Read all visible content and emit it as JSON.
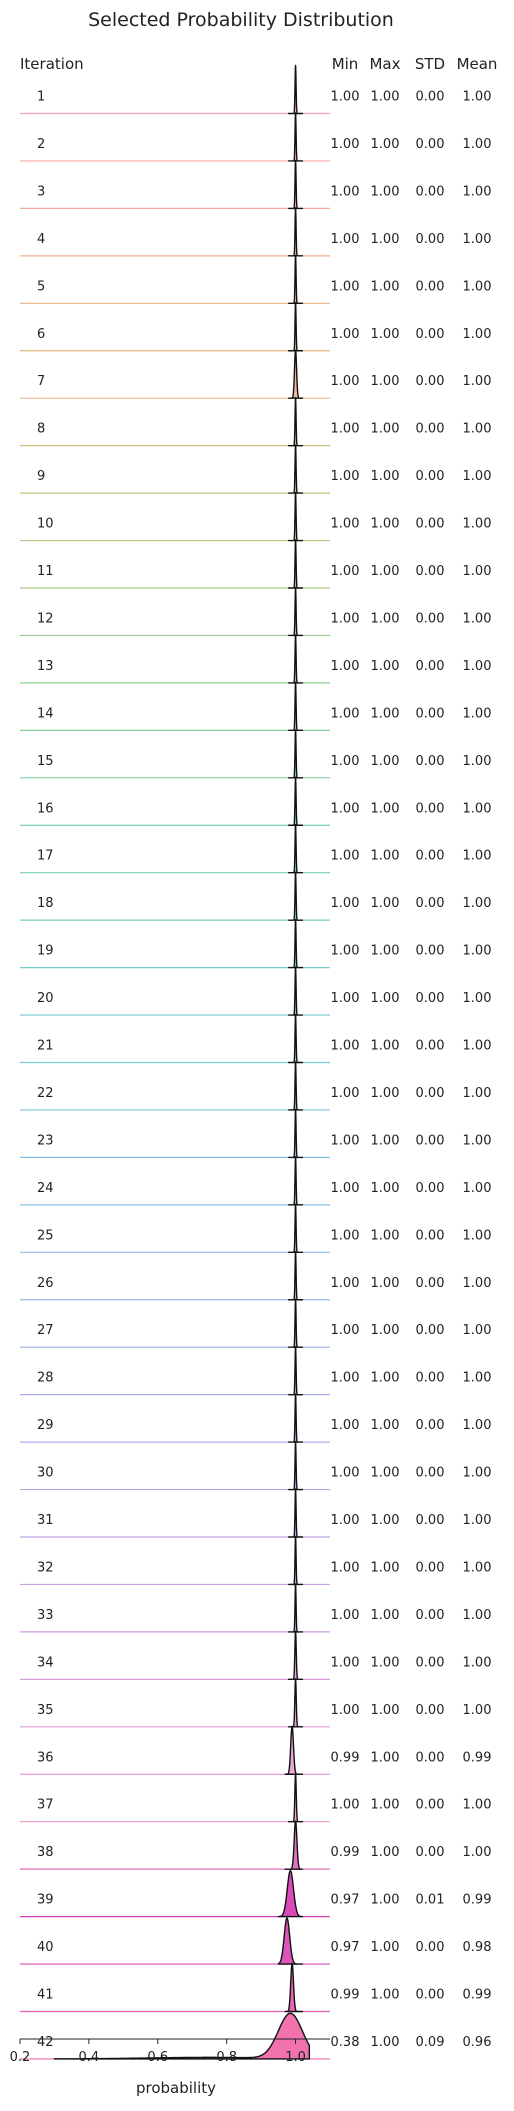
{
  "chart_data": {
    "type": "ridgeline",
    "title": "Selected Probability Distribution",
    "xlabel": "probability",
    "ylabel": "Iteration",
    "xlim": [
      0.2,
      1.1
    ],
    "xticks": [
      "0.2",
      "0.4",
      "0.6",
      "0.8",
      "1.0"
    ],
    "xtick_values": [
      0.2,
      0.4,
      0.6,
      0.8,
      1.0
    ],
    "grid": false,
    "stat_headers": [
      "Min",
      "Max",
      "STD",
      "Mean"
    ],
    "rows": [
      {
        "iteration": "1",
        "min": "1.00",
        "max": "1.00",
        "std": "0.00",
        "mean": "1.00",
        "color": "#f6a5b4",
        "spread": 0.0015
      },
      {
        "iteration": "2",
        "min": "1.00",
        "max": "1.00",
        "std": "0.00",
        "mean": "1.00",
        "color": "#f5a7a6",
        "spread": 0.0015
      },
      {
        "iteration": "3",
        "min": "1.00",
        "max": "1.00",
        "std": "0.00",
        "mean": "1.00",
        "color": "#f3aa9a",
        "spread": 0.0015
      },
      {
        "iteration": "4",
        "min": "1.00",
        "max": "1.00",
        "std": "0.00",
        "mean": "1.00",
        "color": "#f0ad8c",
        "spread": 0.0015
      },
      {
        "iteration": "5",
        "min": "1.00",
        "max": "1.00",
        "std": "0.00",
        "mean": "1.00",
        "color": "#e9b382",
        "spread": 0.0015
      },
      {
        "iteration": "6",
        "min": "1.00",
        "max": "1.00",
        "std": "0.00",
        "mean": "1.00",
        "color": "#dfb97d",
        "spread": 0.0015
      },
      {
        "iteration": "7",
        "min": "1.00",
        "max": "1.00",
        "std": "0.00",
        "mean": "1.00",
        "color": "#f0b08e",
        "spread": 0.003
      },
      {
        "iteration": "8",
        "min": "1.00",
        "max": "1.00",
        "std": "0.00",
        "mean": "1.00",
        "color": "#cdbf7e",
        "spread": 0.0015
      },
      {
        "iteration": "9",
        "min": "1.00",
        "max": "1.00",
        "std": "0.00",
        "mean": "1.00",
        "color": "#c4c47e",
        "spread": 0.0015
      },
      {
        "iteration": "10",
        "min": "1.00",
        "max": "1.00",
        "std": "0.00",
        "mean": "1.00",
        "color": "#b8c77f",
        "spread": 0.0015
      },
      {
        "iteration": "11",
        "min": "1.00",
        "max": "1.00",
        "std": "0.00",
        "mean": "1.00",
        "color": "#aac983",
        "spread": 0.0015
      },
      {
        "iteration": "12",
        "min": "1.00",
        "max": "1.00",
        "std": "0.00",
        "mean": "1.00",
        "color": "#9ccc88",
        "spread": 0.0015
      },
      {
        "iteration": "13",
        "min": "1.00",
        "max": "1.00",
        "std": "0.00",
        "mean": "1.00",
        "color": "#8fce8f",
        "spread": 0.0015
      },
      {
        "iteration": "14",
        "min": "1.00",
        "max": "1.00",
        "std": "0.00",
        "mean": "1.00",
        "color": "#85cf99",
        "spread": 0.0015
      },
      {
        "iteration": "15",
        "min": "1.00",
        "max": "1.00",
        "std": "0.00",
        "mean": "1.00",
        "color": "#7fd0a3",
        "spread": 0.0015
      },
      {
        "iteration": "16",
        "min": "1.00",
        "max": "1.00",
        "std": "0.00",
        "mean": "1.00",
        "color": "#7ad0ad",
        "spread": 0.0015
      },
      {
        "iteration": "17",
        "min": "1.00",
        "max": "1.00",
        "std": "0.00",
        "mean": "1.00",
        "color": "#77cfb7",
        "spread": 0.0015
      },
      {
        "iteration": "18",
        "min": "1.00",
        "max": "1.00",
        "std": "0.00",
        "mean": "1.00",
        "color": "#76cec0",
        "spread": 0.0015
      },
      {
        "iteration": "19",
        "min": "1.00",
        "max": "1.00",
        "std": "0.00",
        "mean": "1.00",
        "color": "#76ccc8",
        "spread": 0.0015
      },
      {
        "iteration": "20",
        "min": "1.00",
        "max": "1.00",
        "std": "0.00",
        "mean": "1.00",
        "color": "#78cad0",
        "spread": 0.0015
      },
      {
        "iteration": "21",
        "min": "1.00",
        "max": "1.00",
        "std": "0.00",
        "mean": "1.00",
        "color": "#7bc8d6",
        "spread": 0.0015
      },
      {
        "iteration": "22",
        "min": "1.00",
        "max": "1.00",
        "std": "0.00",
        "mean": "1.00",
        "color": "#7fc5dc",
        "spread": 0.0015
      },
      {
        "iteration": "23",
        "min": "1.00",
        "max": "1.00",
        "std": "0.00",
        "mean": "1.00",
        "color": "#84c2e1",
        "spread": 0.0015
      },
      {
        "iteration": "24",
        "min": "1.00",
        "max": "1.00",
        "std": "0.00",
        "mean": "1.00",
        "color": "#8abfe5",
        "spread": 0.0015
      },
      {
        "iteration": "25",
        "min": "1.00",
        "max": "1.00",
        "std": "0.00",
        "mean": "1.00",
        "color": "#90bbe8",
        "spread": 0.0015
      },
      {
        "iteration": "26",
        "min": "1.00",
        "max": "1.00",
        "std": "0.00",
        "mean": "1.00",
        "color": "#97b7ea",
        "spread": 0.0015
      },
      {
        "iteration": "27",
        "min": "1.00",
        "max": "1.00",
        "std": "0.00",
        "mean": "1.00",
        "color": "#9fb3ec",
        "spread": 0.0015
      },
      {
        "iteration": "28",
        "min": "1.00",
        "max": "1.00",
        "std": "0.00",
        "mean": "1.00",
        "color": "#a7afed",
        "spread": 0.0015
      },
      {
        "iteration": "29",
        "min": "1.00",
        "max": "1.00",
        "std": "0.00",
        "mean": "1.00",
        "color": "#afabed",
        "spread": 0.0015
      },
      {
        "iteration": "30",
        "min": "1.00",
        "max": "1.00",
        "std": "0.00",
        "mean": "1.00",
        "color": "#b7a7ec",
        "spread": 0.0015
      },
      {
        "iteration": "31",
        "min": "1.00",
        "max": "1.00",
        "std": "0.00",
        "mean": "1.00",
        "color": "#c0a3ea",
        "spread": 0.0015
      },
      {
        "iteration": "32",
        "min": "1.00",
        "max": "1.00",
        "std": "0.00",
        "mean": "1.00",
        "color": "#c8a0e7",
        "spread": 0.0015
      },
      {
        "iteration": "33",
        "min": "1.00",
        "max": "1.00",
        "std": "0.00",
        "mean": "1.00",
        "color": "#d09ee3",
        "spread": 0.0015
      },
      {
        "iteration": "34",
        "min": "1.00",
        "max": "1.00",
        "std": "0.00",
        "mean": "1.00",
        "color": "#d89cde",
        "spread": 0.002
      },
      {
        "iteration": "35",
        "min": "1.00",
        "max": "1.00",
        "std": "0.00",
        "mean": "1.00",
        "color": "#df9ad8",
        "spread": 0.002
      },
      {
        "iteration": "36",
        "min": "0.99",
        "max": "1.00",
        "std": "0.00",
        "mean": "0.99",
        "color": "#e59ad2",
        "spread": 0.004
      },
      {
        "iteration": "37",
        "min": "1.00",
        "max": "1.00",
        "std": "0.00",
        "mean": "1.00",
        "color": "#ea9acb",
        "spread": 0.002
      },
      {
        "iteration": "38",
        "min": "0.99",
        "max": "1.00",
        "std": "0.00",
        "mean": "1.00",
        "color": "#e06ab9",
        "spread": 0.004
      },
      {
        "iteration": "39",
        "min": "0.97",
        "max": "1.00",
        "std": "0.01",
        "mean": "0.99",
        "color": "#d73fb6",
        "spread": 0.009
      },
      {
        "iteration": "40",
        "min": "0.97",
        "max": "1.00",
        "std": "0.00",
        "mean": "0.98",
        "color": "#d94cb6",
        "spread": 0.008
      },
      {
        "iteration": "41",
        "min": "0.99",
        "max": "1.00",
        "std": "0.00",
        "mean": "0.99",
        "color": "#e65fb0",
        "spread": 0.004
      },
      {
        "iteration": "42",
        "min": "0.38",
        "max": "1.00",
        "std": "0.09",
        "mean": "0.96",
        "color": "#f06aa8",
        "spread": 0.03
      }
    ]
  }
}
